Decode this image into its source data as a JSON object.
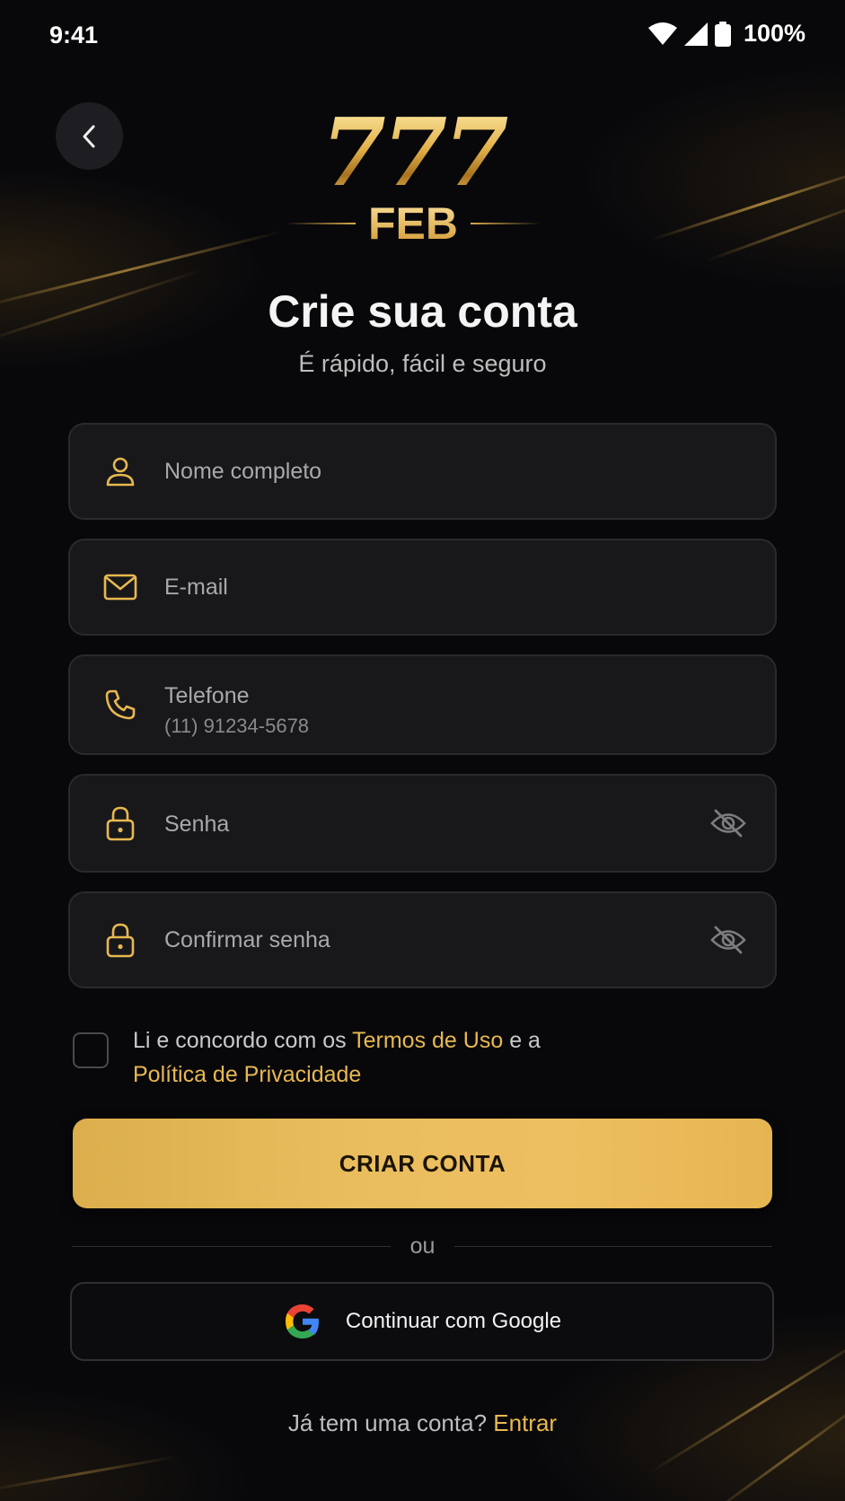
{
  "status_bar": {
    "time": "9:41",
    "battery": "100%"
  },
  "brand": {
    "logo_number": "777",
    "logo_name": "FEB"
  },
  "header": {
    "title": "Crie sua conta",
    "subtitle": "É rápido, fácil e seguro"
  },
  "form": {
    "name_placeholder": "Nome completo",
    "email_placeholder": "E-mail",
    "phone_label": "Telefone",
    "phone_hint": "(11) 91234-5678",
    "password_placeholder": "Senha",
    "confirm_password_placeholder": "Confirmar senha"
  },
  "terms": {
    "prefix": "Li e concordo com os ",
    "terms_link": "Termos de Uso",
    "middle": " e a",
    "privacy_link": "Política de Privacidade",
    "checked": false
  },
  "actions": {
    "create_account": "CRIAR CONTA",
    "divider": "ou",
    "google": "Continuar com Google"
  },
  "footer": {
    "question": "Já tem uma conta? ",
    "login_link": "Entrar"
  },
  "colors": {
    "accent": "#e8b84f",
    "background": "#08080b",
    "field_bg": "#18181b",
    "button_text": "#1b1406"
  },
  "icons": [
    "chevron-left-icon",
    "user-icon",
    "mail-icon",
    "phone-icon",
    "lock-icon",
    "eye-off-icon",
    "google-icon",
    "wifi-icon",
    "signal-icon",
    "battery-icon"
  ]
}
